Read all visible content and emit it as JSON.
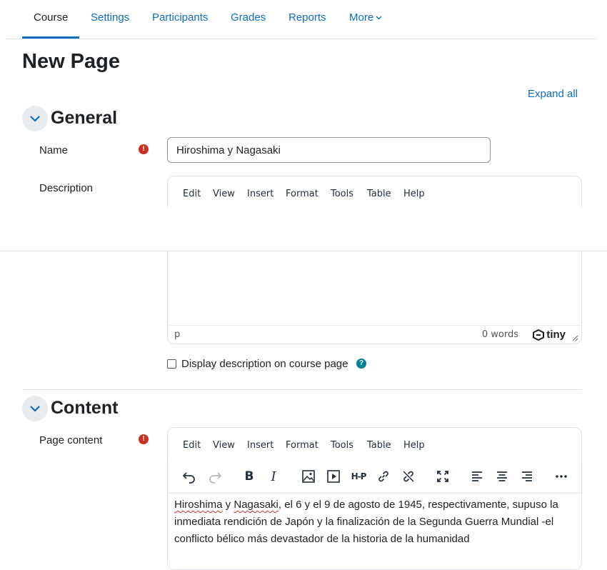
{
  "nav": {
    "tabs": [
      {
        "label": "Course",
        "active": true
      },
      {
        "label": "Settings",
        "active": false
      },
      {
        "label": "Participants",
        "active": false
      },
      {
        "label": "Grades",
        "active": false
      },
      {
        "label": "Reports",
        "active": false
      },
      {
        "label": "More",
        "active": false
      }
    ]
  },
  "page": {
    "title": "New Page",
    "expand_all": "Expand all"
  },
  "general": {
    "title": "General",
    "name_label": "Name",
    "name_value": "Hiroshima y Nagasaki",
    "description_label": "Description",
    "display_description_label": "Display description on course page"
  },
  "editor_menu": [
    "Edit",
    "View",
    "Insert",
    "Format",
    "Tools",
    "Table",
    "Help"
  ],
  "description_editor": {
    "status_path": "p",
    "word_count": "0 words",
    "brand": "tiny"
  },
  "content": {
    "title": "Content",
    "page_content_label": "Page content",
    "text_spell_1": "Hiroshima",
    "text_mid_1": " y ",
    "text_spell_2": "Nagasaki",
    "text_rest": ", el 6 y el 9 de agosto de 1945, respectivamente, supuso la inmediata rendición de Japón y la finalización de la Segunda Guerra Mundial -el conflicto bélico más devastador de la historia de la humanidad"
  },
  "toolbar_icons": [
    "undo-icon",
    "redo-icon",
    "bold-icon",
    "italic-icon",
    "image-icon",
    "media-icon",
    "h5p-icon",
    "link-icon",
    "unlink-icon",
    "fullscreen-icon",
    "align-left-icon",
    "align-center-icon",
    "align-right-icon",
    "more-icon"
  ],
  "colors": {
    "link": "#0f6cbf",
    "required": "#ca3120",
    "help": "#008196"
  }
}
